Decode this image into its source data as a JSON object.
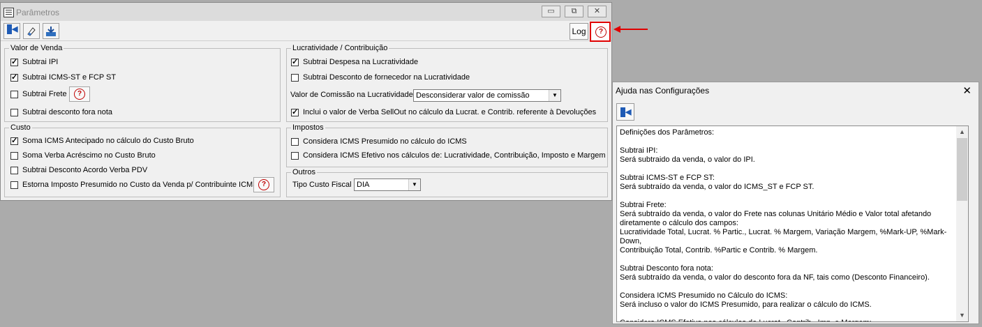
{
  "main_window": {
    "title": "Parâmetros",
    "controls": {
      "minimize": "▭",
      "restore": "⧉",
      "close": "✕"
    },
    "toolbar": {
      "log_label": "Log",
      "tools": [
        "exit-icon",
        "eraser-icon",
        "save-icon"
      ],
      "help_icon": "?"
    },
    "groups": {
      "valor_venda": {
        "legend": "Valor de Venda",
        "items": [
          {
            "label": "Subtrai IPI",
            "checked": true
          },
          {
            "label": "Subtrai ICMS-ST e FCP ST",
            "checked": true
          },
          {
            "label": "Subtrai Frete",
            "checked": false
          },
          {
            "label": "Subtrai desconto fora nota",
            "checked": false
          }
        ]
      },
      "custo": {
        "legend": "Custo",
        "items": [
          {
            "label": "Soma ICMS Antecipado no cálculo do Custo Bruto",
            "checked": true
          },
          {
            "label": "Soma Verba Acréscimo no Custo Bruto",
            "checked": false
          },
          {
            "label": "Subtrai Desconto Acordo Verba PDV",
            "checked": false
          },
          {
            "label": "Estorna Imposto Presumido no Custo da Venda p/ Contribuinte ICMS",
            "checked": false
          }
        ]
      },
      "lucratividade": {
        "legend": "Lucratividade / Contribuição",
        "items": [
          {
            "label": "Subtrai Despesa na Lucratividade",
            "checked": true
          },
          {
            "label": "Subtrai Desconto de fornecedor na Lucratividade",
            "checked": false
          }
        ],
        "comissao_label": "Valor de Comissão na Lucratividade:",
        "comissao_value": "Desconsiderar valor de comissão",
        "verba_item": {
          "label": "Inclui o valor de Verba SellOut no cálculo da Lucrat. e Contrib. referente à Devoluções",
          "checked": true
        }
      },
      "impostos": {
        "legend": "Impostos",
        "items": [
          {
            "label": "Considera ICMS Presumido no cálculo do ICMS",
            "checked": false
          },
          {
            "label": "Considera ICMS Efetivo nos cálculos de: Lucratividade, Contribuição, Imposto e Margem",
            "checked": false
          }
        ]
      },
      "outros": {
        "legend": "Outros",
        "tipo_custo_label": "Tipo Custo Fiscal",
        "tipo_custo_value": "DIA"
      }
    }
  },
  "help_window": {
    "title": "Ajuda nas Configurações",
    "close": "✕",
    "lines": [
      "Definições dos Parâmetros:",
      "",
      "Subtrai IPI:",
      "Será subtraido da venda, o valor do IPI.",
      "",
      "Subtrai ICMS-ST e FCP ST:",
      "Será subtraído da venda, o valor do ICMS_ST e FCP ST.",
      "",
      "Subtrai Frete:",
      "Será subtraído da venda, o valor do Frete nas colunas Unitário Médio e Valor total afetando",
      "diretamente o cálculo dos campos:",
      "Lucratividade Total, Lucrat. % Partic., Lucrat. % Margem, Variação Margem, %Mark-UP, %Mark-Down,",
      "Contribuição Total, Contrib. %Partic e Contrib. % Margem.",
      "",
      "Subtrai Desconto fora nota:",
      "Será subtraído da venda, o valor do desconto fora da NF, tais como (Desconto Financeiro).",
      "",
      "Considera ICMS Presumido no Cálculo do ICMS:",
      "Será incluso o valor do ICMS Presumido, para realizar o cálculo do ICMS.",
      "",
      "Considera ICMS Efetivo nos cálculos de Lucrat., Contrib., Imp. e Margem:"
    ]
  },
  "colors": {
    "highlight": "#e00000",
    "help_icon": "#c00000",
    "desktop": "#ababab"
  }
}
